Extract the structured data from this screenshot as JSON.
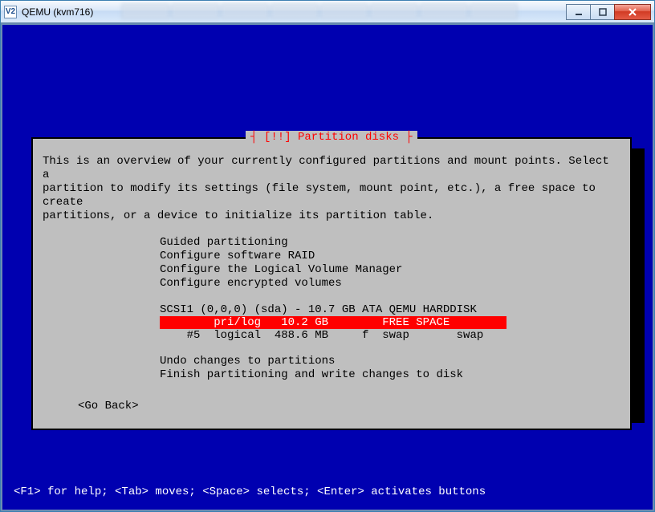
{
  "window": {
    "app_icon_text": "V2",
    "title": "QEMU (kvm716)"
  },
  "dialog": {
    "title_prefix": "┤ ",
    "title": "[!!] Partition disks",
    "title_suffix": " ├",
    "intro": "This is an overview of your currently configured partitions and mount points. Select a\npartition to modify its settings (file system, mount point, etc.), a free space to create\npartitions, or a device to initialize its partition table.",
    "menu": {
      "guided": "Guided partitioning",
      "raid": "Configure software RAID",
      "lvm": "Configure the Logical Volume Manager",
      "encrypted": "Configure encrypted volumes"
    },
    "disk_header": "SCSI1 (0,0,0) (sda) - 10.7 GB ATA QEMU HARDDISK",
    "partitions": {
      "row0": "        pri/log   10.2 GB        FREE SPACE",
      "row1": "    #5  logical  488.6 MB     f  swap       swap"
    },
    "undo": "Undo changes to partitions",
    "finish": "Finish partitioning and write changes to disk",
    "go_back": "<Go Back>"
  },
  "help_line": "<F1> for help; <Tab> moves; <Space> selects; <Enter> activates buttons"
}
